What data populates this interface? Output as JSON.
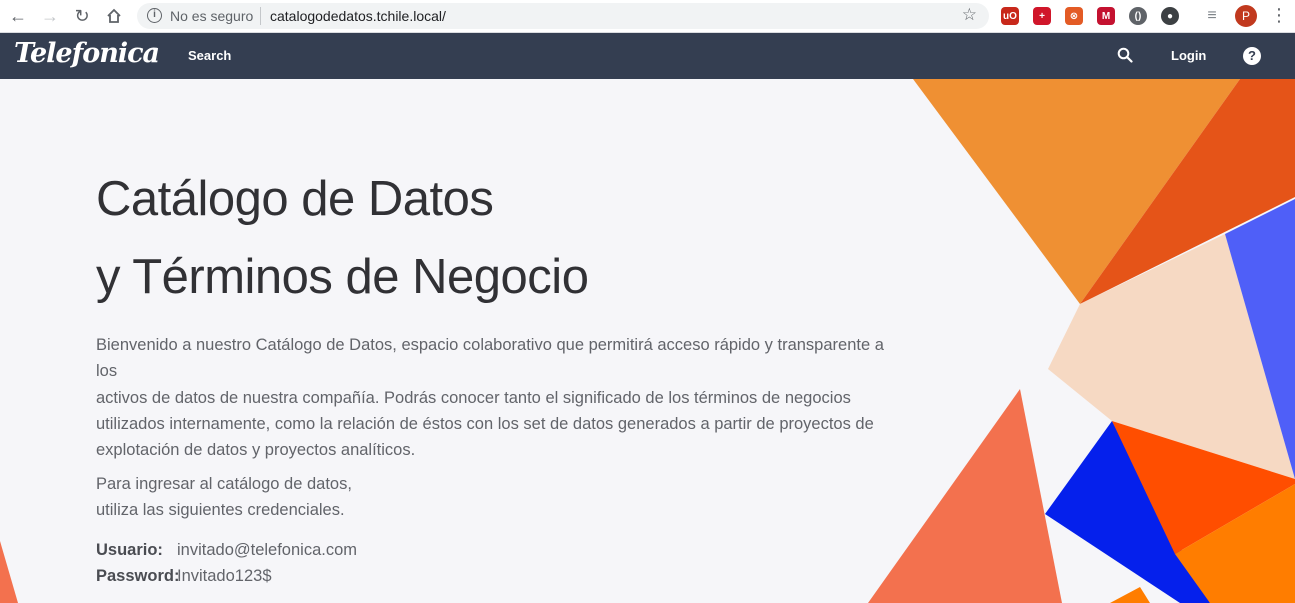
{
  "browser": {
    "not_secure": "No es seguro",
    "url": "catalogodedatos.tchile.local/",
    "profile_initial": "P",
    "extensions": [
      {
        "icon": "ublock-icon",
        "color": "#c8281b",
        "glyph": "uO"
      },
      {
        "icon": "shield-plus-icon",
        "color": "#d0162a",
        "glyph": "+"
      },
      {
        "icon": "orange-circle-icon",
        "color": "#e35b25",
        "glyph": "⊗"
      },
      {
        "icon": "mcafee-icon",
        "color": "#c41230",
        "glyph": "M"
      },
      {
        "icon": "code-icon",
        "color": "#5f6368",
        "glyph": "()"
      },
      {
        "icon": "dark-circle-icon",
        "color": "#3c4043",
        "glyph": "●"
      },
      {
        "icon": "reading-list-icon",
        "color": "#80868b",
        "glyph": "≡"
      }
    ]
  },
  "header": {
    "logo": "Telefonica",
    "search_label": "Search",
    "login_label": "Login",
    "help_glyph": "?"
  },
  "hero": {
    "title_line1": "Catálogo de Datos",
    "title_line2": "y Términos de Negocio",
    "intro_lines": [
      "Bienvenido a nuestro Catálogo de Datos, espacio colaborativo que permitirá acceso rápido y transparente a los",
      "activos de datos de nuestra compañía. Podrás conocer tanto el significado de los términos de negocios",
      "utilizados internamente, como la relación de éstos con los set de datos generados a partir de proyectos de",
      "explotación de datos y proyectos analíticos."
    ],
    "cred_intro_lines": [
      "Para ingresar al catálogo de datos,",
      "utiliza las siguientes credenciales."
    ],
    "user_label": "Usuario:",
    "user_value": "invitado@telefonica.com",
    "password_label": "Password:",
    "password_value": "Invitado123$"
  },
  "colors": {
    "header_bg": "#343e51",
    "orange": "#ef9033",
    "dark_orange": "#e55418",
    "peach": "#f6d9c3",
    "blue_violet": "#4f5ff8",
    "coral": "#f3714e",
    "blue": "#0520ec",
    "red_orange": "#ff4e00",
    "bright_orange": "#ff7d00"
  }
}
